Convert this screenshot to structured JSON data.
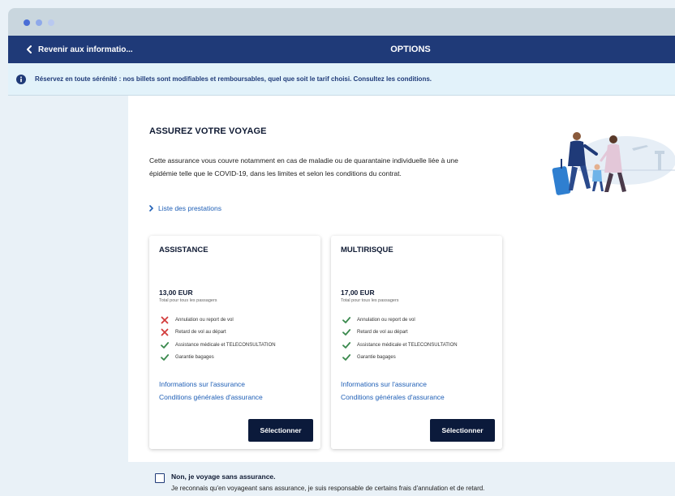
{
  "window": {
    "dots": [
      "#4a6ed6",
      "#8fa9ea",
      "#b9c9f0"
    ]
  },
  "nav": {
    "back_label": "Revenir aux informatio...",
    "title": "OPTIONS"
  },
  "banner": {
    "text": "Réservez en toute sérénité : nos billets sont modifiables et remboursables, quel que soit le tarif choisi. Consultez les conditions."
  },
  "insurance": {
    "title": "ASSUREZ VOTRE VOYAGE",
    "description": "Cette assurance vous couvre notamment en cas de maladie ou de quarantaine individuelle liée à une épidémie telle que le COVID-19, dans les limites et selon les conditions du contrat.",
    "benefits_link": "Liste des prestations",
    "cards": [
      {
        "title": "ASSISTANCE",
        "price": "13,00 EUR",
        "price_note": "Total pour tous les passagers",
        "features": [
          {
            "label": "Annulation ou report de vol",
            "included": false
          },
          {
            "label": "Retard de vol au départ",
            "included": false
          },
          {
            "label": "Assistance médicale et TELECONSULTATION",
            "included": true
          },
          {
            "label": "Garantie bagages",
            "included": true
          }
        ],
        "info_link": "Informations sur l'assurance",
        "terms_link": "Conditions générales d'assurance",
        "button": "Sélectionner"
      },
      {
        "title": "MULTIRISQUE",
        "price": "17,00 EUR",
        "price_note": "Total pour tous les passagers",
        "features": [
          {
            "label": "Annulation ou report de vol",
            "included": true
          },
          {
            "label": "Retard de vol au départ",
            "included": true
          },
          {
            "label": "Assistance médicale et TELECONSULTATION",
            "included": true
          },
          {
            "label": "Garantie bagages",
            "included": true
          }
        ],
        "info_link": "Informations sur l'assurance",
        "terms_link": "Conditions générales d'assurance",
        "button": "Sélectionner"
      }
    ],
    "no_insurance": {
      "title": "Non, je voyage sans assurance.",
      "description": "Je reconnais qu'en voyageant sans assurance, je suis responsable de certains frais d'annulation et de retard."
    }
  },
  "colors": {
    "nav_bg": "#1f3a78",
    "button_bg": "#0b1a3b",
    "link": "#1f5fb6",
    "check": "#3b8a4e",
    "cross": "#d23b3b"
  }
}
